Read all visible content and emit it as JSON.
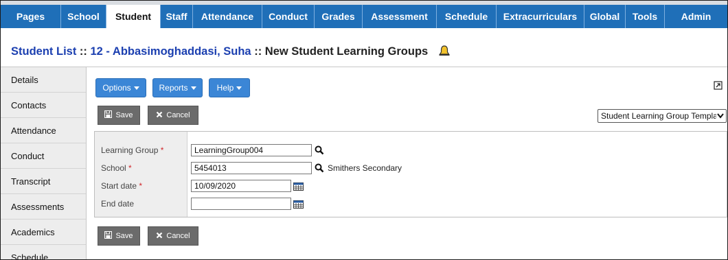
{
  "nav": {
    "tabs": [
      {
        "label": "Pages"
      },
      {
        "label": "School"
      },
      {
        "label": "Student",
        "active": true
      },
      {
        "label": "Staff"
      },
      {
        "label": "Attendance"
      },
      {
        "label": "Conduct"
      },
      {
        "label": "Grades"
      },
      {
        "label": "Assessment"
      },
      {
        "label": "Schedule"
      },
      {
        "label": "Extracurriculars"
      },
      {
        "label": "Global"
      },
      {
        "label": "Tools"
      },
      {
        "label": "Admin"
      }
    ]
  },
  "header": {
    "crumb1": "Student List",
    "sep1": " :: ",
    "crumb2": "12 - Abbasimoghaddasi, Suha",
    "sep2": " :: ",
    "crumb3": "New Student Learning Groups"
  },
  "sidebar": {
    "items": [
      {
        "label": "Details"
      },
      {
        "label": "Contacts"
      },
      {
        "label": "Attendance"
      },
      {
        "label": "Conduct"
      },
      {
        "label": "Transcript"
      },
      {
        "label": "Assessments"
      },
      {
        "label": "Academics"
      },
      {
        "label": "Schedule"
      }
    ]
  },
  "toolbar": {
    "options_label": "Options",
    "reports_label": "Reports",
    "help_label": "Help",
    "save_label": "Save",
    "cancel_label": "Cancel",
    "template_select": "Student Learning Group Template"
  },
  "form": {
    "learning_group": {
      "label": "Learning Group",
      "required": "*",
      "value": "LearningGroup004"
    },
    "school": {
      "label": "School",
      "required": "*",
      "value": "5454013",
      "name": "Smithers Secondary"
    },
    "start_date": {
      "label": "Start date",
      "required": "*",
      "value": "10/09/2020"
    },
    "end_date": {
      "label": "End date",
      "value": ""
    }
  },
  "colors": {
    "nav_bg": "#1f6fb8",
    "title_link": "#1b3fb0",
    "button_blue": "#3b86d6",
    "button_gray": "#6b6b6b",
    "required": "#d0262a"
  },
  "icons": [
    "bell-icon",
    "popout-icon",
    "save-icon",
    "cancel-icon",
    "search-icon",
    "calendar-icon"
  ]
}
